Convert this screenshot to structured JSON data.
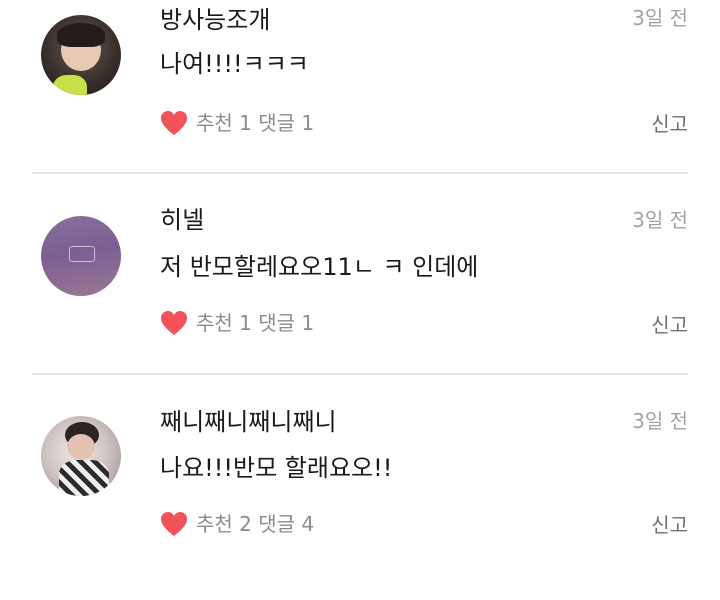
{
  "comments": [
    {
      "username": "방사능조개",
      "time": "3일 전",
      "text": "나여!!!!ㅋㅋㅋ",
      "stats": "추천 1 댓글 1",
      "report": "신고"
    },
    {
      "username": "히넬",
      "time": "3일 전",
      "text": "저 반모할레요오11ㄴ ㅋ 인데에",
      "stats": "추천 1 댓글 1",
      "report": "신고"
    },
    {
      "username": "째니째니째니째니",
      "time": "3일 전",
      "text": "나요!!!반모 할래요오!!",
      "stats": "추천 2 댓글 4",
      "report": "신고"
    }
  ],
  "colors": {
    "heart": "#f2525a",
    "divider": "#e4e4e4",
    "muted": "#a3a3a3"
  },
  "icons": {
    "like": "heart-icon",
    "avatar": "avatar"
  }
}
